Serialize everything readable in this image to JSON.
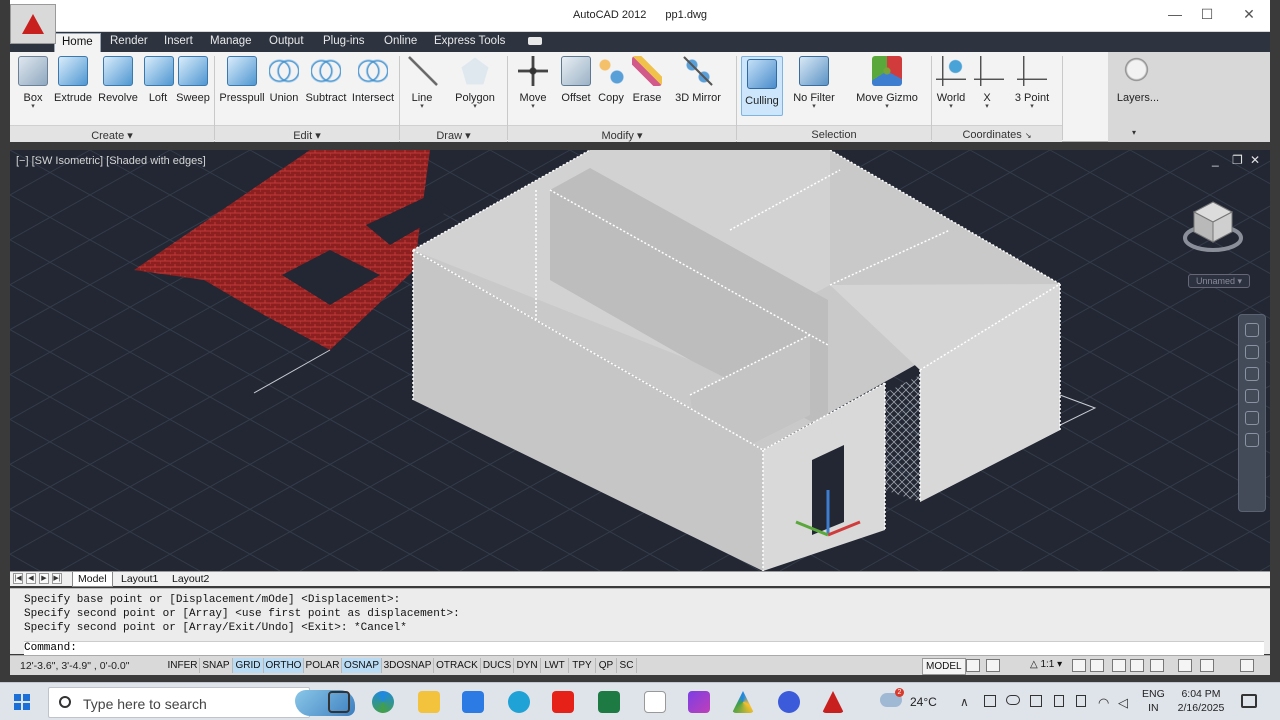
{
  "window": {
    "app_name": "AutoCAD 2012",
    "file_name": "pp1.dwg",
    "min_icon": "minimize-icon",
    "max_icon": "maximize-icon",
    "close_icon": "close-icon"
  },
  "ribbon": {
    "tabs": [
      "Home",
      "Render",
      "Insert",
      "Manage",
      "Output",
      "Plug-ins",
      "Online",
      "Express Tools"
    ],
    "active_tab": "Home",
    "tools": {
      "create": [
        "Box",
        "Extrude",
        "Revolve",
        "Loft",
        "Sweep"
      ],
      "edit": [
        "Presspull",
        "Union",
        "Subtract",
        "Intersect"
      ],
      "draw": [
        "Line",
        "Polygon"
      ],
      "modify": [
        "Move",
        "Offset",
        "Copy",
        "Erase",
        "3D Mirror"
      ],
      "selection": [
        "Culling",
        "No Filter",
        "Move Gizmo"
      ],
      "coordinates": [
        "World",
        "X",
        "3 Point"
      ],
      "layers": "Layers..."
    },
    "groups": {
      "create": "Create",
      "edit": "Edit",
      "draw": "Draw",
      "modify": "Modify",
      "selection": "Selection",
      "coordinates": "Coordinates"
    },
    "dropdown_arrow": "▾",
    "launcher": "↘"
  },
  "viewport": {
    "label": "[−] [SW Isometric] [Shaded with edges]",
    "viewcube_label": "Unnamed",
    "controls": [
      "_",
      "❐",
      "✕"
    ],
    "colors": {
      "background": "#222733",
      "grid": "#343b4a",
      "wall_light": "#d7d7d7",
      "wall_mid": "#bdbdbd",
      "wall_dark": "#a7a7a7",
      "brick": "#8c1f1f",
      "brick_line": "#c23a3a"
    }
  },
  "layout_tabs": {
    "tabs": [
      "Model",
      "Layout1",
      "Layout2"
    ],
    "active": "Model"
  },
  "command": {
    "history": [
      "Specify base point or [Displacement/mOde] <Displacement>:",
      "Specify second point or [Array] <use first point as displacement>:",
      "Specify second point or [Array/Exit/Undo] <Exit>: *Cancel*"
    ],
    "prompt": "Command:"
  },
  "status": {
    "coordinates": "12'-3.6\",  3'-4.9\"  , 0'-0.0\"",
    "toggles": [
      "INFER",
      "SNAP",
      "GRID",
      "ORTHO",
      "POLAR",
      "OSNAP",
      "3DOSNAP",
      "OTRACK",
      "DUCS",
      "DYN",
      "LWT",
      "TPY",
      "QP",
      "SC"
    ],
    "toggles_on": [
      "GRID",
      "ORTHO",
      "OSNAP"
    ],
    "model": "MODEL",
    "scale": "1:1 ▾"
  },
  "taskbar": {
    "search_placeholder": "Type here to search",
    "weather": "24°C",
    "weather_badge": "2",
    "language": "ENG",
    "region": "IN",
    "time": "6:04 PM",
    "date": "2/16/2025",
    "tray_expand": "∧"
  }
}
